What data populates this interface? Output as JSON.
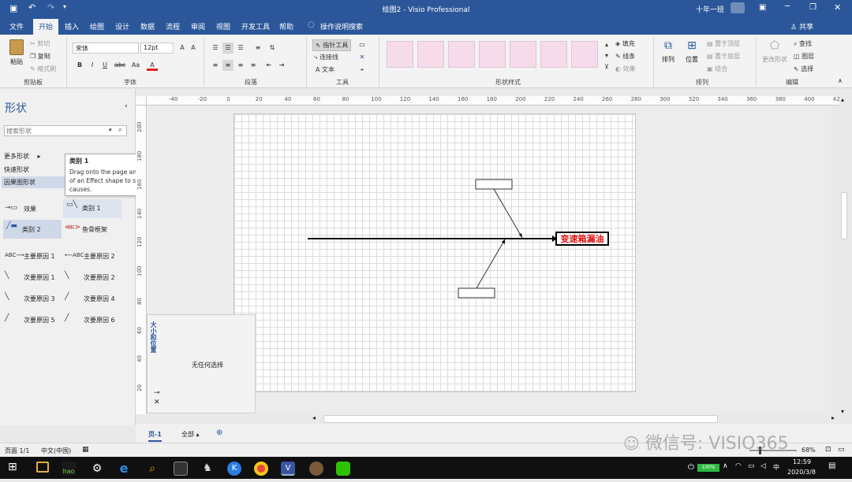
{
  "titlebar": {
    "title": "绘图2 - Visio Professional",
    "user": "十年一班"
  },
  "tabs": [
    "文件",
    "开始",
    "插入",
    "绘图",
    "设计",
    "数据",
    "流程",
    "审阅",
    "视图",
    "开发工具",
    "帮助"
  ],
  "tell_me": "操作说明搜索",
  "share": "共享",
  "ribbon": {
    "clipboard": {
      "paste": "粘贴",
      "cut": "剪切",
      "copy": "复制",
      "format_painter": "格式刷",
      "label": "剪贴板"
    },
    "font": {
      "family": "宋体",
      "size": "12pt",
      "grow": "A",
      "shrink": "A",
      "bold": "B",
      "italic": "I",
      "underline": "U",
      "strike": "abc",
      "case": "Aa",
      "color": "A",
      "label": "字体"
    },
    "paragraph": {
      "label": "段落"
    },
    "tools": {
      "pointer": "指针工具",
      "connector": "连接线",
      "text": "文本",
      "label": "工具"
    },
    "shape_styles": {
      "label": "形状样式",
      "fill": "填充",
      "line": "线条",
      "effects": "效果"
    },
    "arrange": {
      "arrange": "排列",
      "position": "位置",
      "bring_front": "置于顶层",
      "send_back": "置于底层",
      "group": "组合",
      "label": "排列"
    },
    "editing": {
      "change_shape": "更改形状",
      "find": "查找",
      "layers": "图层",
      "select": "选择",
      "label": "编辑"
    }
  },
  "shapes_panel": {
    "title": "形状",
    "search_placeholder": "搜索形状",
    "more": "更多形状",
    "quick": "快速形状",
    "stencil": "因果图形状",
    "items": [
      "效果",
      "类别 1",
      "类别 2",
      "鱼骨框架",
      "主要原因 1",
      "主要原因 2",
      "次要原因 1",
      "次要原因 2",
      "次要原因 3",
      "次要原因 4",
      "次要原因 5",
      "次要原因 6"
    ]
  },
  "tooltip": {
    "title": "类别 1",
    "body": "Drag onto the page and connect to the top of an Effect shape to show a category of causes."
  },
  "size_panel": {
    "title": "大小和位置",
    "message": "无任何选择"
  },
  "ruler": {
    "h": [
      "-40",
      "-20",
      "0",
      "20",
      "40",
      "60",
      "80",
      "100",
      "120",
      "140",
      "160",
      "180",
      "200",
      "220",
      "240",
      "260",
      "280",
      "300",
      "320",
      "340",
      "360",
      "380",
      "400",
      "420"
    ],
    "v": [
      "200",
      "180",
      "160",
      "140",
      "120",
      "100",
      "80",
      "60",
      "40",
      "20",
      "0"
    ]
  },
  "diagram": {
    "effect_label": "变速箱漏油"
  },
  "page_tabs": {
    "current": "页-1",
    "all": "全部"
  },
  "status": {
    "page": "页面 1/1",
    "language": "中文(中国)",
    "zoom": "68%"
  },
  "taskbar": {
    "time": "12:59",
    "date": "2020/3/8",
    "battery": "100%",
    "ime": "中"
  },
  "watermark": "微信号: VISIO365"
}
